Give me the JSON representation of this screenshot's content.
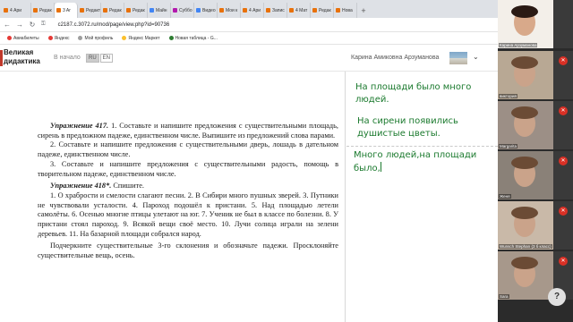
{
  "browser": {
    "tabs": [
      {
        "label": "4 Ари",
        "color": "#e8710a"
      },
      {
        "label": "Редак",
        "color": "#e8710a"
      },
      {
        "label": "3 Ar",
        "color": "#e8710a",
        "active": true
      },
      {
        "label": "Редакт",
        "color": "#e8710a"
      },
      {
        "label": "Редак",
        "color": "#e8710a"
      },
      {
        "label": "Редак",
        "color": "#e8710a"
      },
      {
        "label": "Майн",
        "color": "#4285f4"
      },
      {
        "label": "Суббо",
        "color": "#b31aad"
      },
      {
        "label": "Видео",
        "color": "#4285f4"
      },
      {
        "label": "Мои к",
        "color": "#e8710a"
      },
      {
        "label": "4 Ари",
        "color": "#e8710a"
      },
      {
        "label": "Запис",
        "color": "#e8710a"
      },
      {
        "label": "4 Мат",
        "color": "#e8710a"
      },
      {
        "label": "Редак",
        "color": "#e8710a"
      },
      {
        "label": "Нова",
        "color": "#e8710a"
      }
    ],
    "new_tab": "+",
    "url": "c2187.c.3072.ru/mod/page/view.php?id=90736",
    "bookmarks": [
      {
        "label": "Авиабилеты",
        "color": "#e53935"
      },
      {
        "label": "Яндекс",
        "color": "#e53935"
      },
      {
        "label": "Мой профиль",
        "color": "#9e9e9e"
      },
      {
        "label": "Яндекс Маркет",
        "color": "#fbc02d"
      },
      {
        "label": "Новая таблица - G...",
        "color": "#2e7d32"
      }
    ]
  },
  "site": {
    "logo_line1": "Великая",
    "logo_line2": "дидактика",
    "home_link": "В начало",
    "lang_ru": "RU",
    "lang_en": "EN",
    "username": "Карина Амиковна Арзуманова"
  },
  "document": {
    "ex417_title": "Упражнение 417.",
    "ex417_p1": "1. Составьте и напишите предложения с существительными площадь, сирень в предложном падеже, единственном числе. Выпишите из предложений слова парами.",
    "ex417_p2": "2. Составьте и напишите предложения с существительными дверь, лошадь в дательном падеже, единственном числе.",
    "ex417_p3": "3. Составьте и напишите предложения с существительными радость, помощь в творительном падеже, единственном числе.",
    "ex418_title": "Упражнение 418*.",
    "ex418_instr": "Спишите.",
    "ex418_body": "1. О храбрости и смелости слагают песни. 2. В Сибири много пушных зверей. 3. Путники не чувствовали усталости. 4. Пароход подошёл к пристани. 5. Над площадью летели самолёты. 6. Осенью многие птицы улетают на юг. 7. Ученик не был в классе по болезни. 8. У пристани стоял пароход. 9. Всякой вещи своё место. 10. Лучи солнца играли на зелени деревьев. 11. На базарной площади собрался народ.",
    "ex418_task": "Подчеркните существительные 3-го склонения и обозначьте падежи. Просклоняйте существительные вещь, осень."
  },
  "notes": {
    "line1": "На площади было много людей.",
    "line2": "На сирени появились душистые цветы.",
    "line3": "Много людей,на площади было,"
  },
  "video_call": {
    "participants": [
      {
        "name": "Карина Арзуманова",
        "bg": "#f3efe9",
        "muted": false
      },
      {
        "name": "виктория",
        "bg": "#b8a894",
        "muted": true
      },
      {
        "name": "Margarita",
        "bg": "#9c8f86",
        "muted": true
      },
      {
        "name": "Женя",
        "bg": "#8a8178",
        "muted": true
      },
      {
        "name": "Wunsch Stephan (3 б класс)",
        "bg": "#c9b9a8",
        "muted": true
      },
      {
        "name": "Sara",
        "bg": "#a7988b",
        "muted": true
      }
    ]
  },
  "help_label": "?"
}
